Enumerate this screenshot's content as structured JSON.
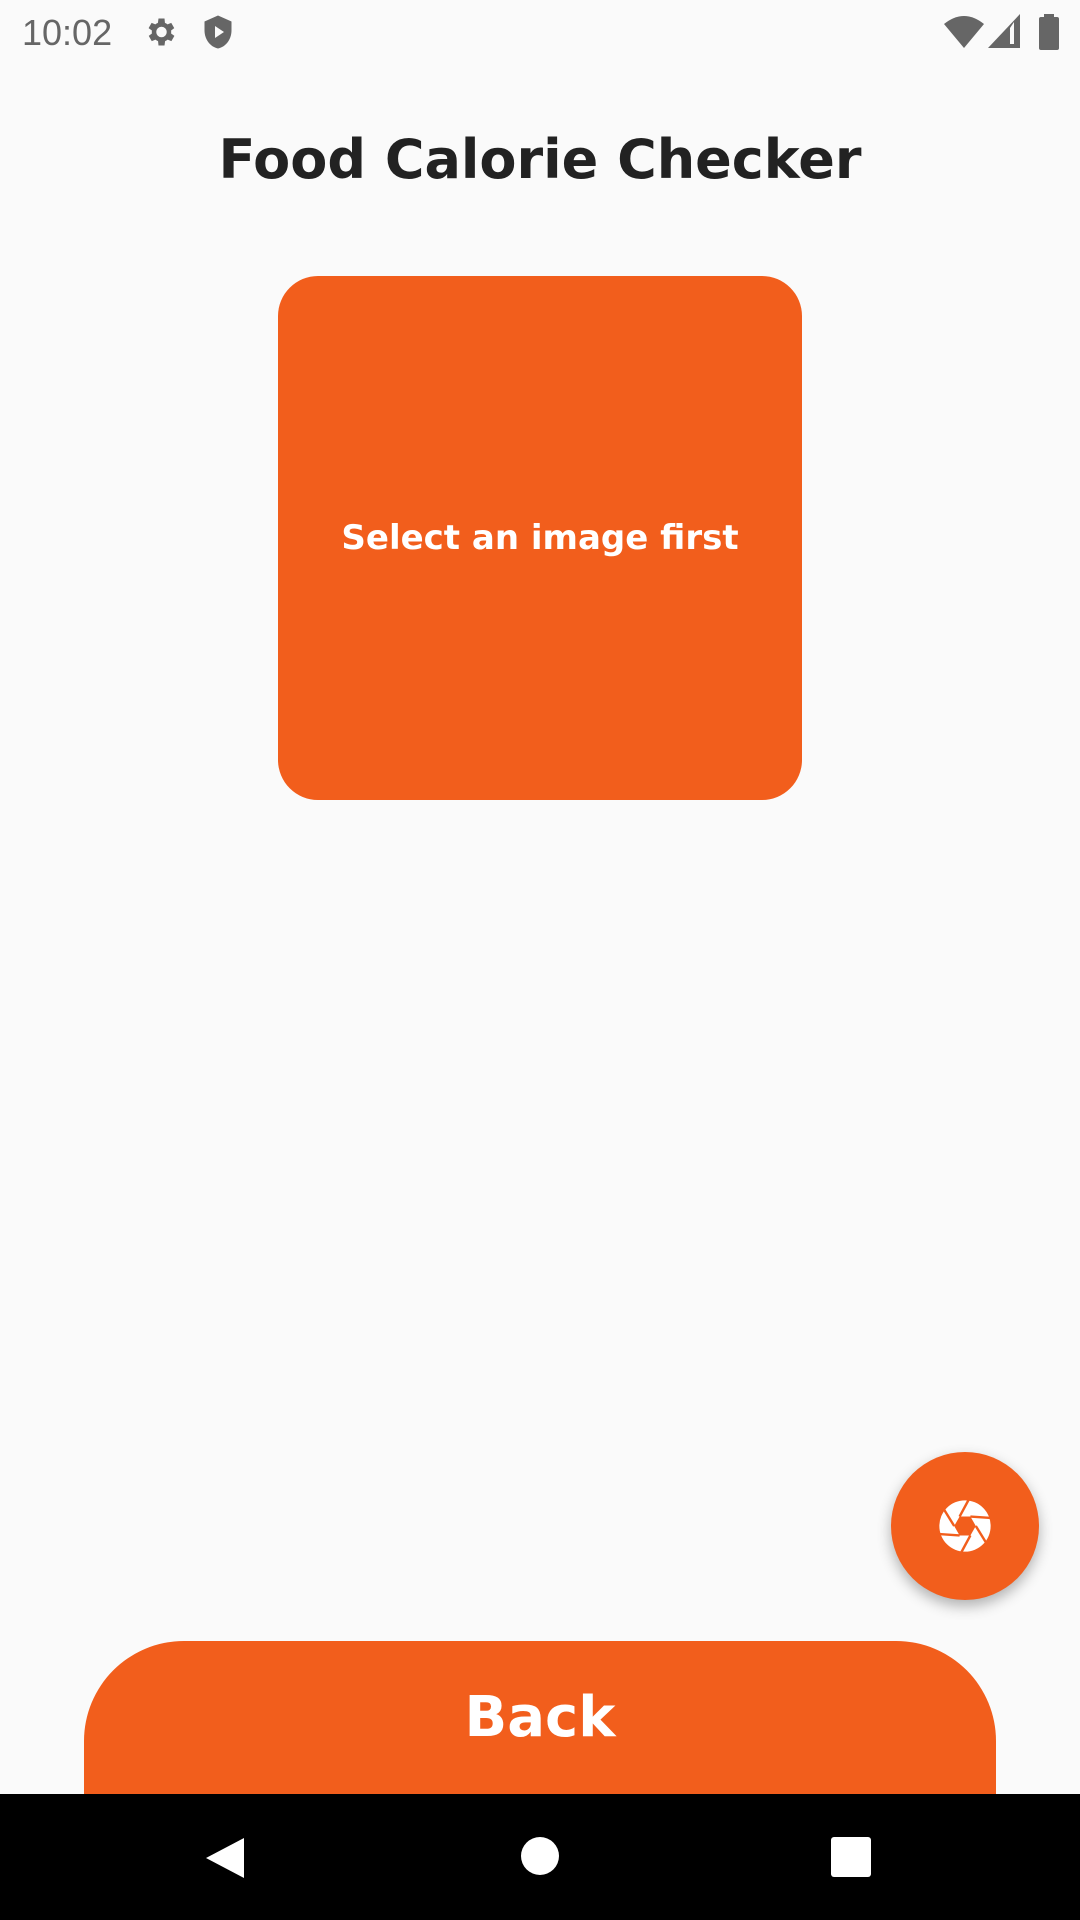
{
  "status_bar": {
    "time": "10:02",
    "icons": [
      "gear-icon",
      "shield-play-icon",
      "wifi-icon",
      "signal-icon",
      "battery-icon"
    ]
  },
  "header": {
    "title": "Food Calorie Checker"
  },
  "image_placeholder": {
    "text": "Select an image first"
  },
  "fab": {
    "icon": "camera-aperture-icon"
  },
  "back_button": {
    "label": "Back"
  },
  "nav_bar": {
    "icons": [
      "back-icon",
      "home-icon",
      "recents-icon"
    ]
  },
  "colors": {
    "accent": "#f25e1c",
    "background": "#fafafa",
    "title": "#222222"
  }
}
